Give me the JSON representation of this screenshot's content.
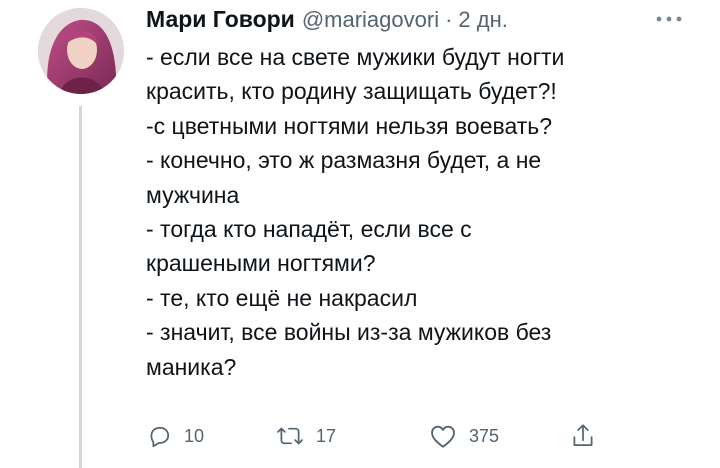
{
  "tweet": {
    "display_name": "Мари Говори",
    "handle": "@mariagovori",
    "separator": "·",
    "timestamp": "2 дн.",
    "lines": [
      "- если все на свете мужики будут ногти",
      "красить, кто родину защищать будет?!",
      "-с цветными ногтями нельзя воевать?",
      "- конечно, это ж размазня будет, а не",
      "мужчина",
      "- тогда кто нападёт, если все с",
      "крашеными ногтями?",
      "- те, кто ещё не накрасил",
      "- значит, все войны из-за мужиков без",
      "маника?"
    ]
  },
  "actions": {
    "reply": {
      "icon": "reply-icon",
      "count": "10"
    },
    "retweet": {
      "icon": "retweet-icon",
      "count": "17"
    },
    "like": {
      "icon": "like-icon",
      "count": "375"
    },
    "share": {
      "icon": "share-icon"
    }
  },
  "colors": {
    "text": "#0f1419",
    "secondary": "#536471",
    "thread_line": "#cfd9de"
  }
}
